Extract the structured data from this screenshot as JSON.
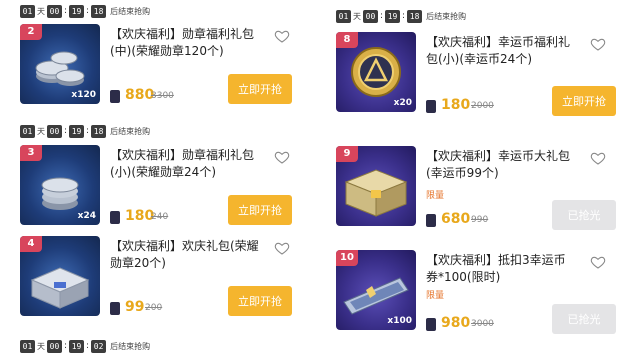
{
  "timer_label": "后结束抢购",
  "unit_day": "天",
  "timers": [
    {
      "d": "01",
      "h": "00",
      "m": "19",
      "s": "18"
    },
    {
      "d": "01",
      "h": "00",
      "m": "19",
      "s": "18"
    },
    {
      "d": "01",
      "h": "00",
      "m": "19",
      "s": "02"
    },
    {
      "d": "01",
      "h": "00",
      "m": "19",
      "s": "18"
    }
  ],
  "left_items": [
    {
      "rank": "2",
      "title": "【欢庆福利】勋章福利礼包(中)(荣耀勋章120个)",
      "qty": "x120",
      "price": "880",
      "orig": "3300",
      "button": "立即开抢"
    },
    {
      "rank": "3",
      "title": "【欢庆福利】勋章福利礼包(小)(荣耀勋章24个)",
      "qty": "x24",
      "price": "180",
      "orig": "240",
      "button": "立即开抢"
    },
    {
      "rank": "4",
      "title": "【欢庆福利】欢庆礼包(荣耀勋章20个)",
      "qty": "",
      "price": "99",
      "orig": "200",
      "button": "立即开抢"
    }
  ],
  "right_items": [
    {
      "rank": "8",
      "title": "【欢庆福利】幸运币福利礼包(小)(幸运币24个)",
      "qty": "x20",
      "price": "180",
      "orig": "2000",
      "button": "立即开抢",
      "limited": ""
    },
    {
      "rank": "9",
      "title": "【欢庆福利】幸运币大礼包(幸运币99个)",
      "qty": "",
      "price": "680",
      "orig": "990",
      "button": "已抢光",
      "limited": "限量"
    },
    {
      "rank": "10",
      "title": "【欢庆福利】抵扣3幸运币券*100(限时)",
      "qty": "x100",
      "price": "980",
      "orig": "3000",
      "button": "已抢光",
      "limited": "限量"
    }
  ],
  "colors": {
    "accent": "#f5b52e",
    "price": "#e8a81c",
    "rank": "#d8455c",
    "limited": "#e5742b"
  }
}
